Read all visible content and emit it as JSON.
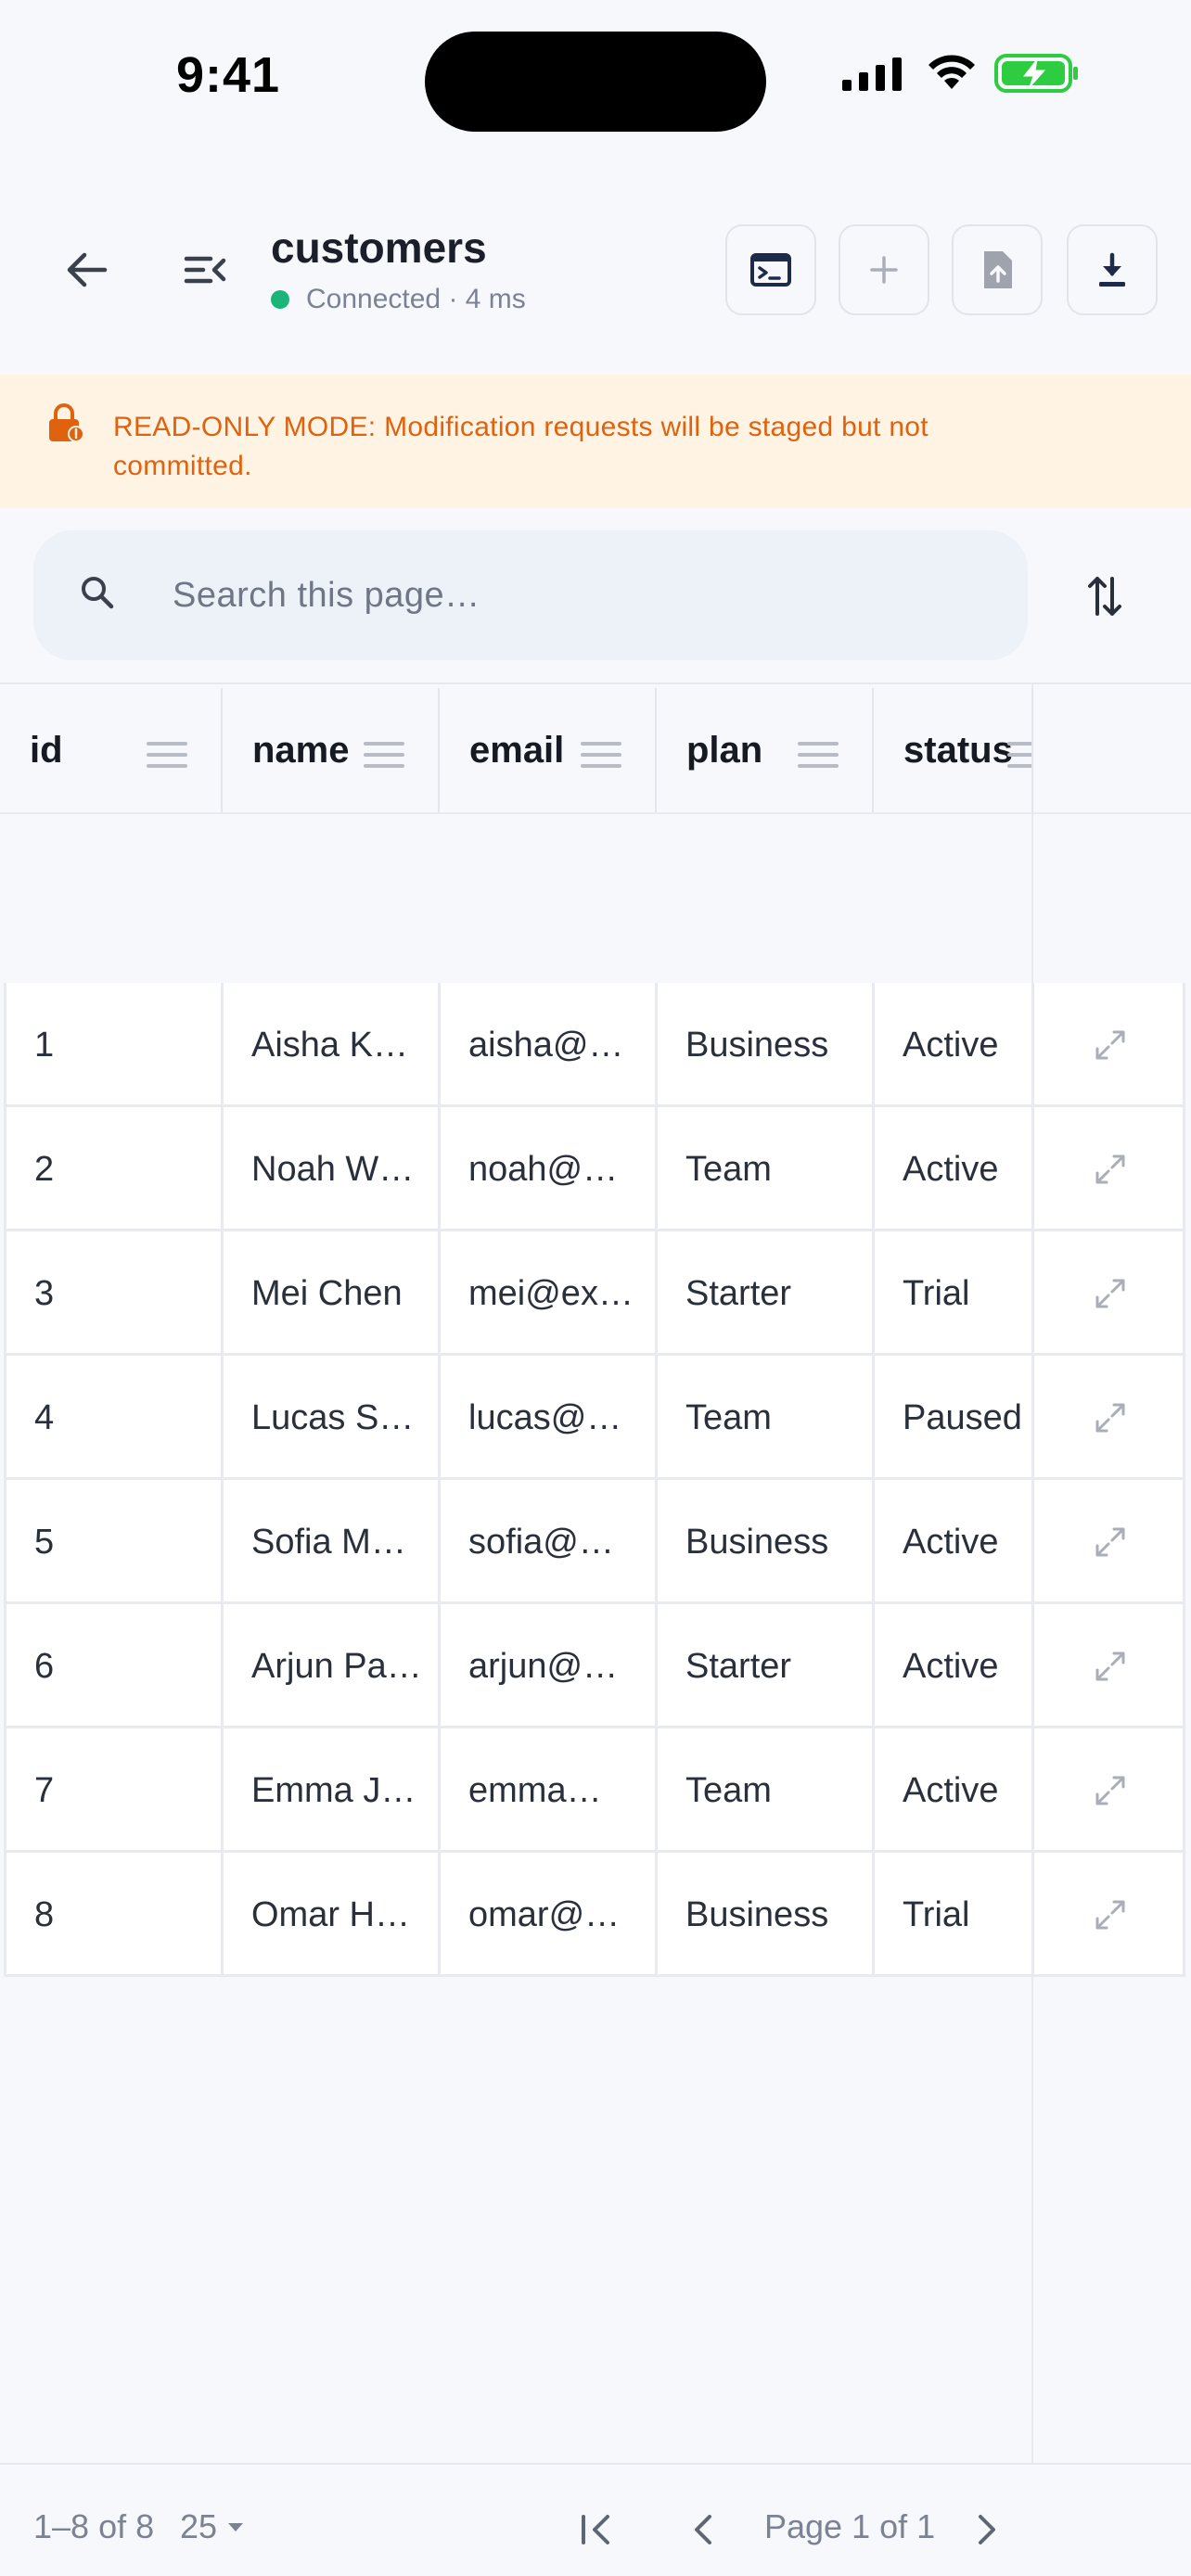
{
  "status_bar": {
    "time": "9:41"
  },
  "header": {
    "table_name": "customers",
    "connection_status": "Connected · 4 ms"
  },
  "banner": {
    "text": "READ-ONLY MODE: Modification requests will be staged but not committed."
  },
  "search": {
    "placeholder": "Search this page…",
    "value": ""
  },
  "table": {
    "columns": [
      "id",
      "name",
      "email",
      "plan",
      "status"
    ],
    "rows": [
      [
        "1",
        "Aisha K…",
        "aisha@…",
        "Business",
        "Active"
      ],
      [
        "2",
        "Noah W…",
        "noah@…",
        "Team",
        "Active"
      ],
      [
        "3",
        "Mei Chen",
        "mei@ex…",
        "Starter",
        "Trial"
      ],
      [
        "4",
        "Lucas S…",
        "lucas@…",
        "Team",
        "Paused"
      ],
      [
        "5",
        "Sofia M…",
        "sofia@…",
        "Business",
        "Active"
      ],
      [
        "6",
        "Arjun Pa…",
        "arjun@…",
        "Starter",
        "Active"
      ],
      [
        "7",
        "Emma J…",
        "emma…",
        "Team",
        "Active"
      ],
      [
        "8",
        "Omar H…",
        "omar@…",
        "Business",
        "Trial"
      ]
    ]
  },
  "footer": {
    "range": "1–8 of 8",
    "page_size": "25",
    "page_label": "Page 1 of 1"
  },
  "colors": {
    "accent_warning": "#e0620e",
    "banner_bg": "#fff3e3",
    "connected_dot": "#1bb57a",
    "battery_green": "#2ecc40"
  },
  "icons": {
    "back": "arrow-left-icon",
    "menu": "menu-collapse-icon",
    "terminal": "terminal-icon",
    "add": "plus-icon",
    "import": "file-upload-icon",
    "export": "download-icon",
    "lock": "lock-icon",
    "search": "search-icon",
    "sort": "sort-icon",
    "expand": "expand-icon"
  }
}
